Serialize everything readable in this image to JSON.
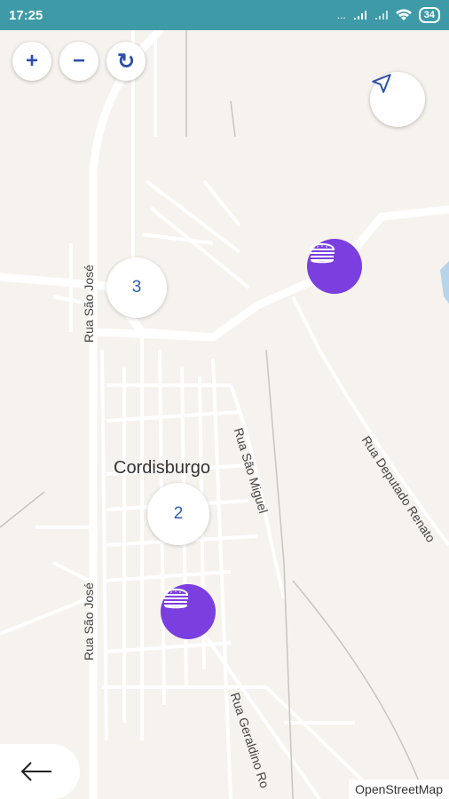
{
  "status_bar": {
    "time": "17:25",
    "signal_dots": "...",
    "battery": "34"
  },
  "map": {
    "town_label": "Cordisburgo",
    "streets": {
      "rua_sao_jose_top": "Rua São José",
      "rua_sao_jose_bottom": "Rua São José",
      "rua_sao_miguel": "Rua São Miguel",
      "rua_deputado_renato": "Rua Deputado Renato",
      "rua_geraldino": "Rua Geraldino Ro"
    },
    "clusters": [
      {
        "count": "3"
      },
      {
        "count": "2"
      }
    ],
    "attribution": "OpenStreetMap"
  },
  "controls": {
    "zoom_in": "+",
    "zoom_out": "−",
    "refresh": "↻"
  },
  "colors": {
    "status_bar": "#3d9aa6",
    "poi": "#7b3fe0",
    "control_icon": "#2d4fa8"
  },
  "icons": {
    "poi": "burger-icon",
    "locate": "navigation-arrow-icon",
    "back": "arrow-left-icon"
  }
}
